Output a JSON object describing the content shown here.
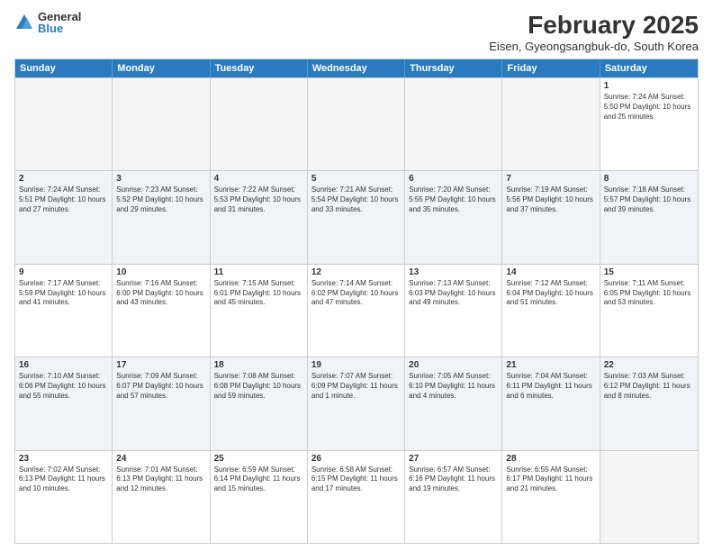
{
  "logo": {
    "general": "General",
    "blue": "Blue"
  },
  "title": "February 2025",
  "subtitle": "Eisen, Gyeongsangbuk-do, South Korea",
  "header_days": [
    "Sunday",
    "Monday",
    "Tuesday",
    "Wednesday",
    "Thursday",
    "Friday",
    "Saturday"
  ],
  "rows": [
    [
      {
        "day": "",
        "info": "",
        "empty": true
      },
      {
        "day": "",
        "info": "",
        "empty": true
      },
      {
        "day": "",
        "info": "",
        "empty": true
      },
      {
        "day": "",
        "info": "",
        "empty": true
      },
      {
        "day": "",
        "info": "",
        "empty": true
      },
      {
        "day": "",
        "info": "",
        "empty": true
      },
      {
        "day": "1",
        "info": "Sunrise: 7:24 AM\nSunset: 5:50 PM\nDaylight: 10 hours and 25 minutes."
      }
    ],
    [
      {
        "day": "2",
        "info": "Sunrise: 7:24 AM\nSunset: 5:51 PM\nDaylight: 10 hours and 27 minutes."
      },
      {
        "day": "3",
        "info": "Sunrise: 7:23 AM\nSunset: 5:52 PM\nDaylight: 10 hours and 29 minutes."
      },
      {
        "day": "4",
        "info": "Sunrise: 7:22 AM\nSunset: 5:53 PM\nDaylight: 10 hours and 31 minutes."
      },
      {
        "day": "5",
        "info": "Sunrise: 7:21 AM\nSunset: 5:54 PM\nDaylight: 10 hours and 33 minutes."
      },
      {
        "day": "6",
        "info": "Sunrise: 7:20 AM\nSunset: 5:55 PM\nDaylight: 10 hours and 35 minutes."
      },
      {
        "day": "7",
        "info": "Sunrise: 7:19 AM\nSunset: 5:56 PM\nDaylight: 10 hours and 37 minutes."
      },
      {
        "day": "8",
        "info": "Sunrise: 7:18 AM\nSunset: 5:57 PM\nDaylight: 10 hours and 39 minutes."
      }
    ],
    [
      {
        "day": "9",
        "info": "Sunrise: 7:17 AM\nSunset: 5:59 PM\nDaylight: 10 hours and 41 minutes."
      },
      {
        "day": "10",
        "info": "Sunrise: 7:16 AM\nSunset: 6:00 PM\nDaylight: 10 hours and 43 minutes."
      },
      {
        "day": "11",
        "info": "Sunrise: 7:15 AM\nSunset: 6:01 PM\nDaylight: 10 hours and 45 minutes."
      },
      {
        "day": "12",
        "info": "Sunrise: 7:14 AM\nSunset: 6:02 PM\nDaylight: 10 hours and 47 minutes."
      },
      {
        "day": "13",
        "info": "Sunrise: 7:13 AM\nSunset: 6:03 PM\nDaylight: 10 hours and 49 minutes."
      },
      {
        "day": "14",
        "info": "Sunrise: 7:12 AM\nSunset: 6:04 PM\nDaylight: 10 hours and 51 minutes."
      },
      {
        "day": "15",
        "info": "Sunrise: 7:11 AM\nSunset: 6:05 PM\nDaylight: 10 hours and 53 minutes."
      }
    ],
    [
      {
        "day": "16",
        "info": "Sunrise: 7:10 AM\nSunset: 6:06 PM\nDaylight: 10 hours and 55 minutes."
      },
      {
        "day": "17",
        "info": "Sunrise: 7:09 AM\nSunset: 6:07 PM\nDaylight: 10 hours and 57 minutes."
      },
      {
        "day": "18",
        "info": "Sunrise: 7:08 AM\nSunset: 6:08 PM\nDaylight: 10 hours and 59 minutes."
      },
      {
        "day": "19",
        "info": "Sunrise: 7:07 AM\nSunset: 6:09 PM\nDaylight: 11 hours and 1 minute."
      },
      {
        "day": "20",
        "info": "Sunrise: 7:05 AM\nSunset: 6:10 PM\nDaylight: 11 hours and 4 minutes."
      },
      {
        "day": "21",
        "info": "Sunrise: 7:04 AM\nSunset: 6:11 PM\nDaylight: 11 hours and 6 minutes."
      },
      {
        "day": "22",
        "info": "Sunrise: 7:03 AM\nSunset: 6:12 PM\nDaylight: 11 hours and 8 minutes."
      }
    ],
    [
      {
        "day": "23",
        "info": "Sunrise: 7:02 AM\nSunset: 6:13 PM\nDaylight: 11 hours and 10 minutes."
      },
      {
        "day": "24",
        "info": "Sunrise: 7:01 AM\nSunset: 6:13 PM\nDaylight: 11 hours and 12 minutes."
      },
      {
        "day": "25",
        "info": "Sunrise: 6:59 AM\nSunset: 6:14 PM\nDaylight: 11 hours and 15 minutes."
      },
      {
        "day": "26",
        "info": "Sunrise: 6:58 AM\nSunset: 6:15 PM\nDaylight: 11 hours and 17 minutes."
      },
      {
        "day": "27",
        "info": "Sunrise: 6:57 AM\nSunset: 6:16 PM\nDaylight: 11 hours and 19 minutes."
      },
      {
        "day": "28",
        "info": "Sunrise: 6:55 AM\nSunset: 6:17 PM\nDaylight: 11 hours and 21 minutes."
      },
      {
        "day": "",
        "info": "",
        "empty": true
      }
    ]
  ]
}
